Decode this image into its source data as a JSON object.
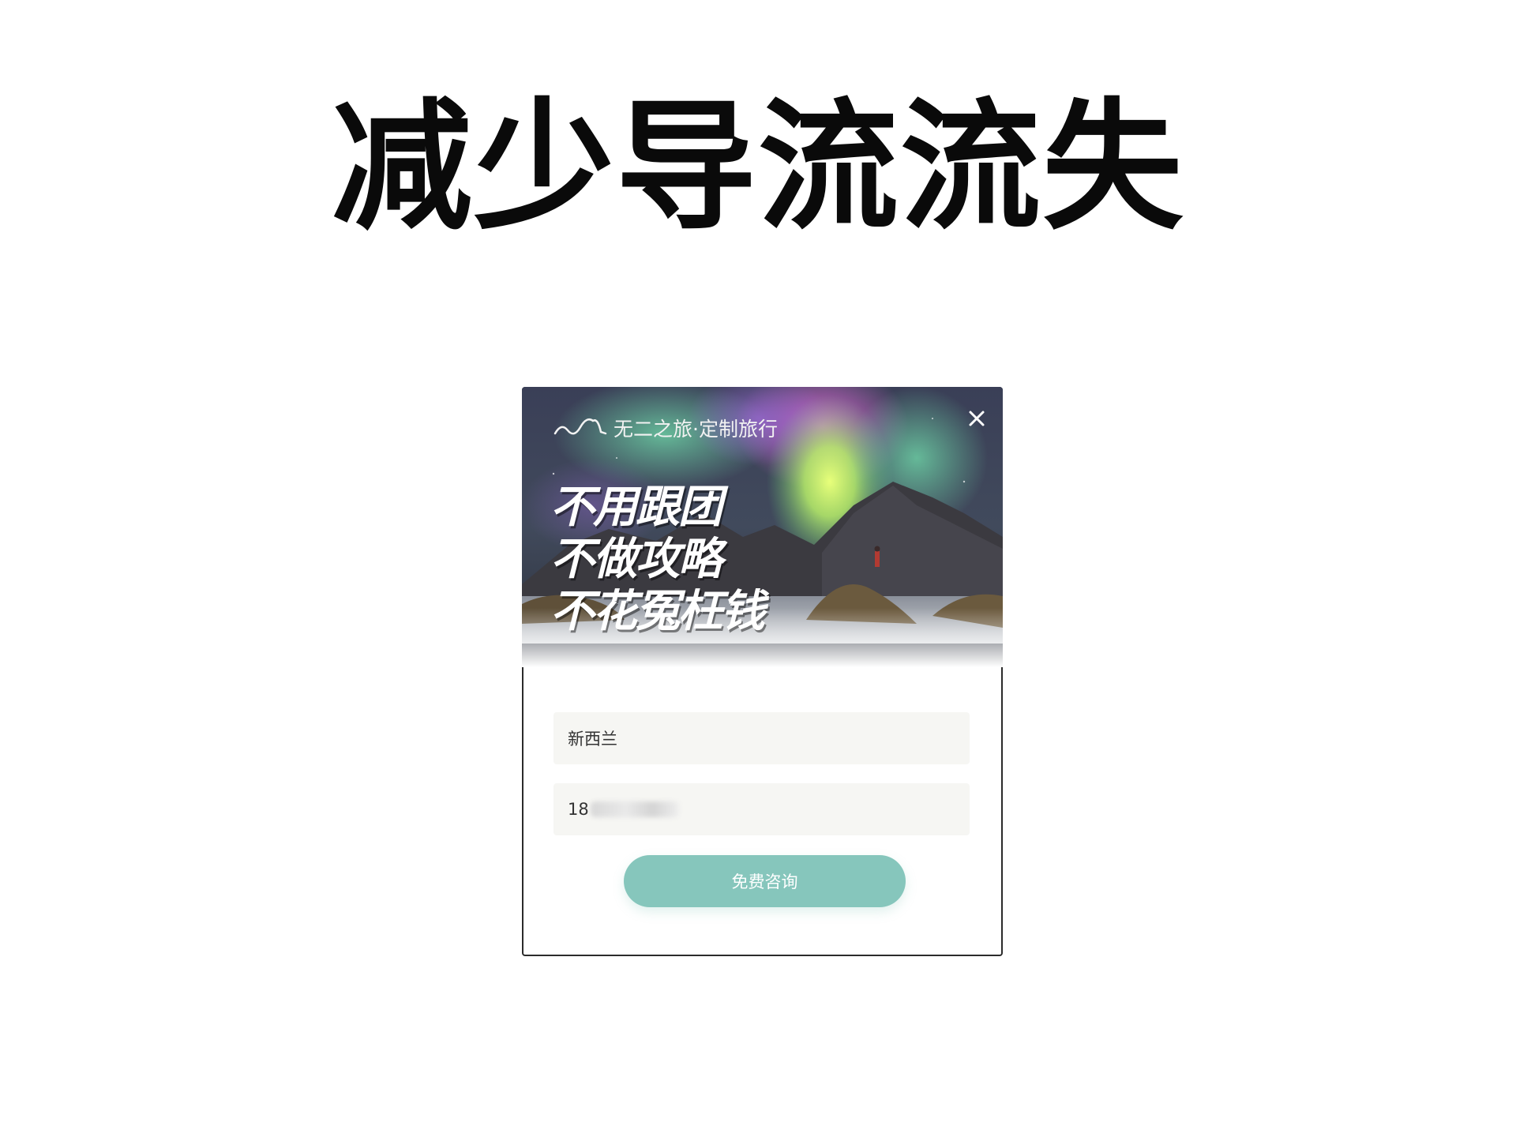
{
  "slide": {
    "title": "减少导流流失"
  },
  "modal": {
    "brand_text": "无二之旅·定制旅行",
    "close_icon": "close-icon",
    "logo_icon": "wave-logo-icon",
    "slogan": [
      "不用跟团",
      "不做攻略",
      "不花冤枉钱"
    ],
    "destination_value": "新西兰",
    "phone_value_visible": "18",
    "submit_label": "免费咨询",
    "colors": {
      "button": "#86c6bc",
      "field_bg": "#f6f6f3"
    }
  }
}
